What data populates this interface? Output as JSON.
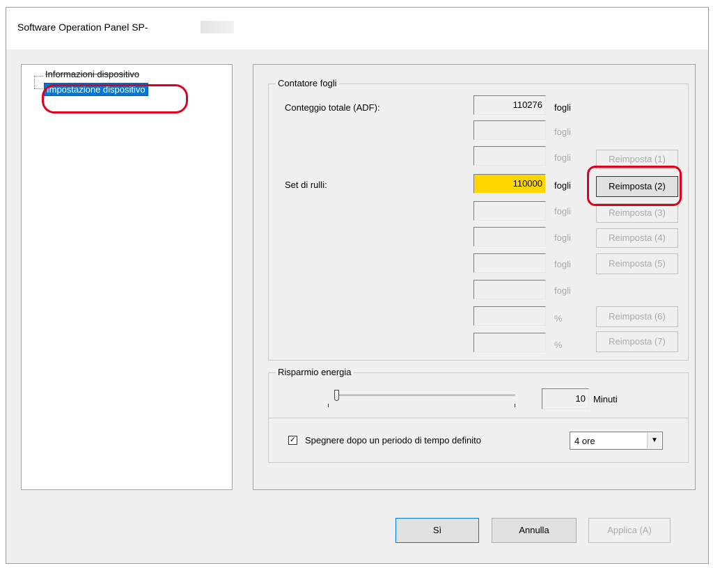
{
  "window": {
    "title": "Software Operation Panel SP-"
  },
  "tree": {
    "items": [
      {
        "label": "Informazioni dispositivo"
      },
      {
        "label": "Impostazione dispositivo"
      }
    ]
  },
  "sheet_counter": {
    "legend": "Contatore fogli",
    "total_label": "Conteggio totale (ADF):",
    "rollers_label": "Set di rulli:",
    "rows": [
      {
        "value": "110276",
        "unit": "fogli",
        "button": null
      },
      {
        "value": "",
        "unit": "fogli",
        "button": null
      },
      {
        "value": "",
        "unit": "fogli",
        "button": "Reimposta (1)"
      },
      {
        "value": "110000",
        "unit": "fogli",
        "button": "Reimposta (2)"
      },
      {
        "value": "",
        "unit": "fogli",
        "button": "Reimposta (3)"
      },
      {
        "value": "",
        "unit": "fogli",
        "button": "Reimposta (4)"
      },
      {
        "value": "",
        "unit": "fogli",
        "button": "Reimposta (5)"
      },
      {
        "value": "",
        "unit": "fogli",
        "button": null
      },
      {
        "value": "",
        "unit": "%",
        "button": "Reimposta (6)"
      },
      {
        "value": "",
        "unit": "%",
        "button": "Reimposta (7)"
      }
    ]
  },
  "power_saving": {
    "legend": "Risparmio energia",
    "minutes_value": "10",
    "minutes_unit": "Minuti",
    "slider_level": 0,
    "checkbox_checked": true,
    "checkbox_label": "Spegnere dopo un periodo di tempo definito",
    "shutdown_option": "4 ore"
  },
  "footer": {
    "ok_label": "Sì",
    "cancel_label": "Annulla",
    "apply_label": "Applica (A)"
  },
  "colors": {
    "highlight_yellow": "#ffd600",
    "annotation_red": "#e0001b",
    "selection_blue": "#0078d7"
  }
}
